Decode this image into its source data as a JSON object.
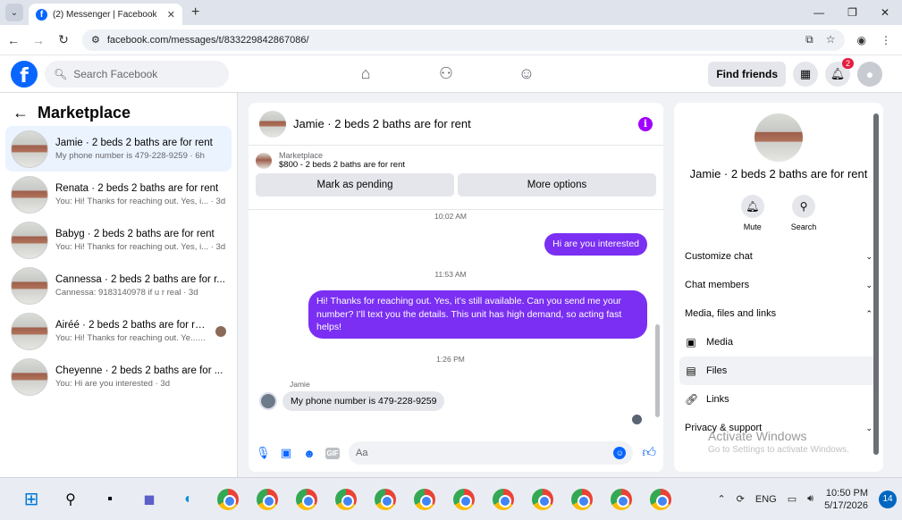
{
  "browser": {
    "tab_title": "(2) Messenger | Facebook",
    "url": "facebook.com/messages/t/833229842867086/"
  },
  "fbnav": {
    "search_placeholder": "Search Facebook",
    "find_friends": "Find friends",
    "notif_count": "2"
  },
  "sidebar": {
    "title": "Marketplace",
    "conversations": [
      {
        "name": "Jamie · 2 beds 2 baths are for rent",
        "snippet": "My phone number is 479-228-9259 · 6h"
      },
      {
        "name": "Renata · 2 beds 2 baths are for rent",
        "snippet": "You: Hi! Thanks for reaching out. Yes, i... · 3d"
      },
      {
        "name": "Babyg · 2 beds 2 baths are for rent",
        "snippet": "You: Hi! Thanks for reaching out. Yes, i... · 3d"
      },
      {
        "name": "Cannessa · 2 beds 2 baths are for r...",
        "snippet": "Cannessa: 9183140978 if u r real · 3d"
      },
      {
        "name": "Airéé · 2 beds 2 baths are for rent",
        "snippet": "You: Hi! Thanks for reaching out. Ye... · 3d"
      },
      {
        "name": "Cheyenne · 2 beds 2 baths are for ...",
        "snippet": "You: Hi are you interested · 3d"
      }
    ]
  },
  "chat": {
    "title": "Jamie · 2 beds 2 baths are for rent",
    "listing_source": "Marketplace",
    "listing_price": "$800 - 2 beds 2 baths are for rent",
    "mark_pending": "Mark as pending",
    "more_options": "More options",
    "messages": {
      "ts1": "10:02 AM",
      "out1": "Hi are you interested",
      "ts2": "11:53 AM",
      "out2": "Hi! Thanks for reaching out. Yes, it’s still available. Can you send me your number? I’ll text you the details. This unit has high demand, so acting fast helps!",
      "ts3": "1:26 PM",
      "sender": "Jamie",
      "in1": "My phone number is 479-228-9259"
    },
    "composer_placeholder": "Aa"
  },
  "rpanel": {
    "name": "Jamie · 2 beds 2 baths are for rent",
    "mute": "Mute",
    "search": "Search",
    "customize": "Customize chat",
    "members": "Chat members",
    "media_section": "Media, files and links",
    "media": "Media",
    "files": "Files",
    "links": "Links",
    "privacy": "Privacy & support"
  },
  "watermark": {
    "title": "Activate Windows",
    "sub": "Go to Settings to activate Windows."
  },
  "taskbar": {
    "lang": "ENG",
    "time": "10:50 PM",
    "date": "5/17/2026",
    "notif": "14"
  }
}
